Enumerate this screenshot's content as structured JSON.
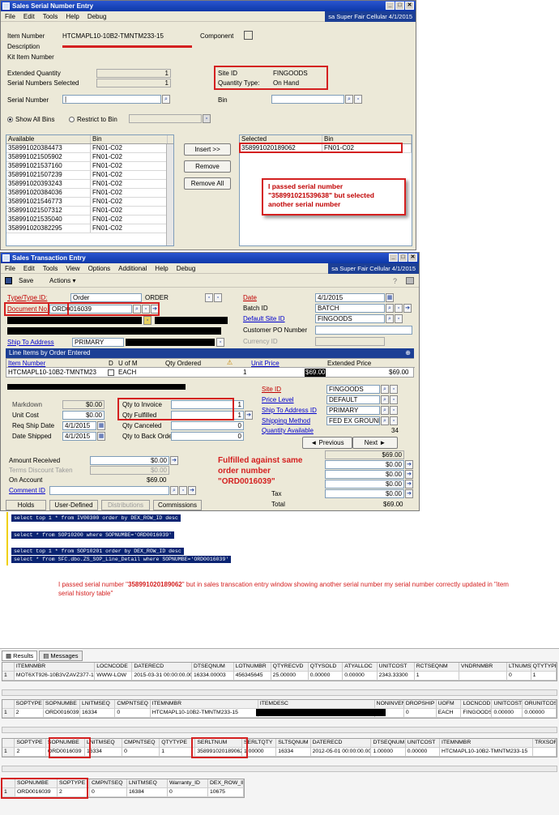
{
  "serial_window": {
    "title": "Sales Serial Number Entry",
    "menu": [
      "File",
      "Edit",
      "Tools",
      "Help",
      "Debug"
    ],
    "company": "sa  Super Fair Cellular  4/1/2015",
    "item_number_label": "Item Number",
    "item_number": "HTCMAPL10-10B2-TMNTM233-15",
    "component_label": "Component",
    "description_label": "Description",
    "kit_item_label": "Kit Item Number",
    "extended_qty_label": "Extended Quantity",
    "extended_qty": "1",
    "serials_selected_label": "Serial Numbers Selected",
    "serials_selected": "1",
    "site_id_label": "Site ID",
    "site_id": "FINGOODS",
    "qty_type_label": "Quantity Type:",
    "qty_type": "On Hand",
    "serial_number_label": "Serial Number",
    "bin_label": "Bin",
    "show_all_bins": "Show All Bins",
    "restrict_to_bin": "Restrict to Bin",
    "available_header": "Available",
    "bin_header": "Bin",
    "available_rows": [
      {
        "serial": "358991020384473",
        "bin": "FN01-C02"
      },
      {
        "serial": "358991021505902",
        "bin": "FN01-C02"
      },
      {
        "serial": "358991021537160",
        "bin": "FN01-C02"
      },
      {
        "serial": "358991021507239",
        "bin": "FN01-C02"
      },
      {
        "serial": "358991020393243",
        "bin": "FN01-C02"
      },
      {
        "serial": "358991020384036",
        "bin": "FN01-C02"
      },
      {
        "serial": "358991021546773",
        "bin": "FN01-C02"
      },
      {
        "serial": "358991021507312",
        "bin": "FN01-C02"
      },
      {
        "serial": "358991021535040",
        "bin": "FN01-C02"
      },
      {
        "serial": "358991020382295",
        "bin": "FN01-C02"
      }
    ],
    "insert_button": "Insert >>",
    "remove_button": "Remove",
    "remove_all_button": "Remove All",
    "selected_header": "Selected",
    "selected_bin_header": "Bin",
    "selected_rows": [
      {
        "serial": "358991020189062",
        "bin": "FN01-C02"
      }
    ],
    "note": "I passed serial number \"358991021539638\" but selected another serial number"
  },
  "sales_window": {
    "title": "Sales Transaction Entry",
    "menu": [
      "File",
      "Edit",
      "Tools",
      "View",
      "Options",
      "Additional",
      "Help",
      "Debug"
    ],
    "company": "sa  Super Fair Cellular  4/1/2015",
    "save_label": "Save",
    "actions_label": "Actions",
    "type_label": "Type/Type ID:",
    "type_value": "Order",
    "type_id": "ORDER",
    "doc_no_label": "Document No.",
    "doc_no": "ORD0016039",
    "date_label": "Date",
    "date_value": "4/1/2015",
    "batch_label": "Batch ID",
    "batch_value": "BATCH",
    "default_site_label": "Default Site ID",
    "default_site_value": "FINGOODS",
    "customer_po_label": "Customer PO Number",
    "currency_label": "Currency ID",
    "ship_to_label": "Ship To Address",
    "ship_to_value": "PRIMARY",
    "line_items_label": "Line Items by Order Entered",
    "col_item": "Item Number",
    "col_d": "D",
    "col_uom": "U of M",
    "col_qty": "Qty Ordered",
    "col_unit_price": "Unit Price",
    "col_ext_price": "Extended Price",
    "line_item": "HTCMAPL10-10B2-TMNTM23",
    "line_uom": "EACH",
    "line_qty": "1",
    "line_unit_price": "$69.00",
    "line_ext_price": "$69.00",
    "markdown_label": "Markdown",
    "markdown_value": "$0.00",
    "unit_cost_label": "Unit Cost",
    "unit_cost_value": "$0.00",
    "req_ship_label": "Req Ship Date",
    "req_ship_value": "4/1/2015",
    "date_shipped_label": "Date Shipped",
    "date_shipped_value": "4/1/2015",
    "qty_invoice_label": "Qty to Invoice",
    "qty_invoice_value": "1",
    "qty_fulfilled_label": "Qty Fulfilled",
    "qty_fulfilled_value": "1",
    "qty_canceled_label": "Qty Canceled",
    "qty_canceled_value": "0",
    "qty_backorder_label": "Qty to Back Order",
    "qty_backorder_value": "0",
    "site_id_label": "Site ID",
    "site_id_value": "FINGOODS",
    "price_level_label": "Price Level",
    "price_level_value": "DEFAULT",
    "ship_to_id_label": "Ship To Address ID",
    "ship_to_id_value": "PRIMARY",
    "shipping_method_label": "Shipping Method",
    "shipping_method_value": "FED EX GROUND",
    "qty_available_label": "Quantity Available",
    "qty_available_value": "34",
    "previous_label": "Previous",
    "next_label": "Next",
    "amount_received_label": "Amount Received",
    "amount_received_value": "$0.00",
    "terms_discount_label": "Terms Discount Taken",
    "terms_discount_value": "$0.00",
    "on_account_label": "On Account",
    "on_account_value": "$69.00",
    "comment_id_label": "Comment ID",
    "totals": [
      "$69.00",
      "$0.00",
      "$0.00",
      "$0.00",
      "$0.00"
    ],
    "tax_label": "Tax",
    "tax_value": "$0.00",
    "total_label": "Total",
    "total_value": "$69.00",
    "tab_holds": "Holds",
    "tab_user_defined": "User-Defined",
    "tab_distributions": "Distributions",
    "tab_commissions": "Commissions",
    "note": "Fulfilled against same order number \"ORD0016039\""
  },
  "sql_lines": [
    "select top 1 * from IV00300 order by DEX_ROW_ID desc",
    "select * from SOP10200 where SOPNUMBE='ORD0016039'",
    "select top 1 * from SOP10201 order by DEX_ROW_ID desc",
    "select * from SFC.dbo.ZS_SOP_Line_Detail where SOPNUMBE='ORD0016039'"
  ],
  "comment_text_prefix": "I passed serial number \"",
  "comment_text_serial": "358991020189062",
  "comment_text_suffix": "\" but in sales transcation entry window showing another serial number my serial number correctly updated in \"item serial history table\"",
  "results": {
    "tab_results": "Results",
    "tab_messages": "Messages",
    "table1": {
      "headers": [
        "",
        "ITEMNMBR",
        "LOCNCODE",
        "DATERECD",
        "DTSEQNUM",
        "LOTNUMBR",
        "QTYRECVD",
        "QTYSOLD",
        "ATYALLOC",
        "UNITCOST",
        "RCTSEQNM",
        "VNDRNMBR",
        "LTNUMSLD",
        "QTYTYPE"
      ],
      "row": [
        "1",
        "MOT6XT926-10B3VZAVZ377-15",
        "WWW-LOW",
        "2015-03-31 00:00:00.000",
        "16334.00003",
        "456345645",
        "25.00000",
        "0.00000",
        "0.00000",
        "2343.33300",
        "1",
        "",
        "0",
        "1"
      ]
    },
    "table2": {
      "headers": [
        "",
        "SOPTYPE",
        "SOPNUMBE",
        "LNITMSEQ",
        "CMPNTSEQ",
        "ITEMNMBR",
        "ITEMDESC",
        "NONINVEN",
        "DROPSHIP",
        "UOFM",
        "LOCNCODE",
        "UNITCOST",
        "ORUNITCOST"
      ],
      "row": [
        "1",
        "2",
        "ORD0016039",
        "16334",
        "0",
        "HTCMAPL10-10B2-TMNTM233-15",
        "",
        "0",
        "0",
        "EACH",
        "FINGOODS",
        "0.00000",
        "0.00000"
      ]
    },
    "table3": {
      "headers": [
        "",
        "SOPTYPE",
        "SOPNUMBE",
        "LNITMSEQ",
        "CMPNTSEQ",
        "QTYTYPE",
        "SERLTNUM",
        "SERLTQTY",
        "SLTSQNUM",
        "DATERECD",
        "DTSEQNUM",
        "UNITCOST",
        "ITEMNMBR",
        "TRXSORCE"
      ],
      "row": [
        "1",
        "2",
        "ORD0016039",
        "16334",
        "0",
        "1",
        "358991020189062",
        "1.00000",
        "16334",
        "2012-05-01 00:00:00.000",
        "1.00000",
        "0.00000",
        "HTCMAPL10-10B2-TMNTM233-15",
        ""
      ]
    },
    "table4": {
      "headers": [
        "",
        "SOPNUMBE",
        "SOPTYPE",
        "CMPNTSEQ",
        "LNITMSEQ",
        "Warranty_ID",
        "DEX_ROW_ID"
      ],
      "row": [
        "1",
        "ORD0016039",
        "2",
        "0",
        "16384",
        "0",
        "10675"
      ]
    }
  },
  "colors": {
    "title_blue": "#0c38a8",
    "annotation_red": "#d42020",
    "sql_bg": "#0a2472"
  }
}
